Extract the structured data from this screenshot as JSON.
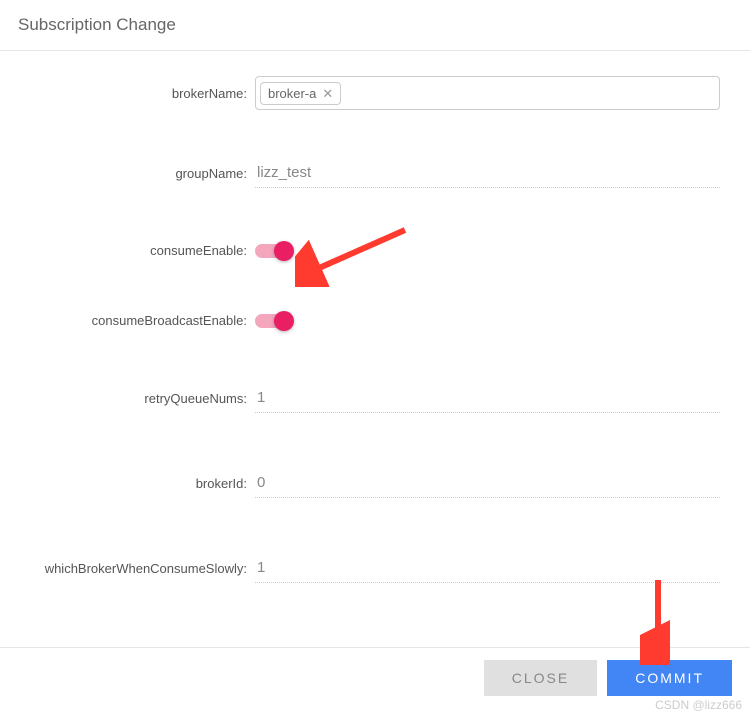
{
  "header": {
    "title": "Subscription Change"
  },
  "form": {
    "brokerName": {
      "label": "brokerName:",
      "tags": [
        "broker-a"
      ]
    },
    "groupName": {
      "label": "groupName:",
      "value": "lizz_test"
    },
    "consumeEnable": {
      "label": "consumeEnable:",
      "value": true
    },
    "consumeBroadcastEnable": {
      "label": "consumeBroadcastEnable:",
      "value": true
    },
    "retryQueueNums": {
      "label": "retryQueueNums:",
      "value": "1"
    },
    "brokerId": {
      "label": "brokerId:",
      "value": "0"
    },
    "whichBrokerWhenConsumeSlowly": {
      "label": "whichBrokerWhenConsumeSlowly:",
      "value": "1"
    }
  },
  "footer": {
    "close": "CLOSE",
    "commit": "COMMIT"
  },
  "watermark": "CSDN @lizz666"
}
